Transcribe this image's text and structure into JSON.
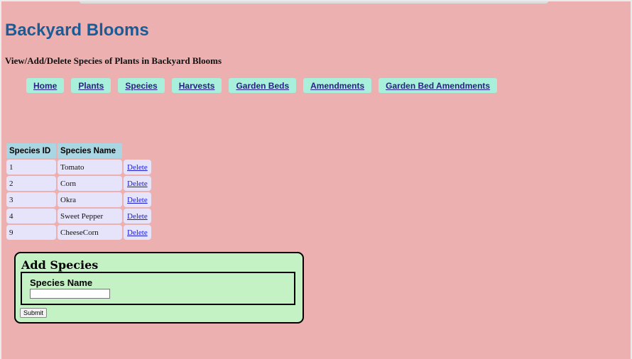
{
  "header": {
    "title": "Backyard Blooms",
    "subtitle": "View/Add/Delete Species of Plants in Backyard Blooms"
  },
  "nav": {
    "items": [
      {
        "label": "Home"
      },
      {
        "label": "Plants"
      },
      {
        "label": "Species"
      },
      {
        "label": "Harvests"
      },
      {
        "label": "Garden Beds"
      },
      {
        "label": "Amendments"
      },
      {
        "label": "Garden Bed Amendments"
      }
    ]
  },
  "table": {
    "headers": [
      "Species ID",
      "Species Name"
    ],
    "rows": [
      {
        "id": "1",
        "name": "Tomato",
        "action": "Delete"
      },
      {
        "id": "2",
        "name": "Corn",
        "action": "Delete"
      },
      {
        "id": "3",
        "name": "Okra",
        "action": "Delete"
      },
      {
        "id": "4",
        "name": "Sweet Pepper",
        "action": "Delete"
      },
      {
        "id": "9",
        "name": "CheeseCorn",
        "action": "Delete"
      }
    ]
  },
  "form": {
    "title": "Add Species",
    "field_label": "Species Name",
    "field_value": "",
    "submit_label": "Submit"
  },
  "colors": {
    "background": "#ecb0b1",
    "title": "#1b5b96",
    "nav_button": "#a8f0dc",
    "nav_text": "#2a1f86",
    "table_header": "#a9d6e2",
    "table_cell": "#e6e4fa",
    "form_box": "#c4f2c4"
  }
}
